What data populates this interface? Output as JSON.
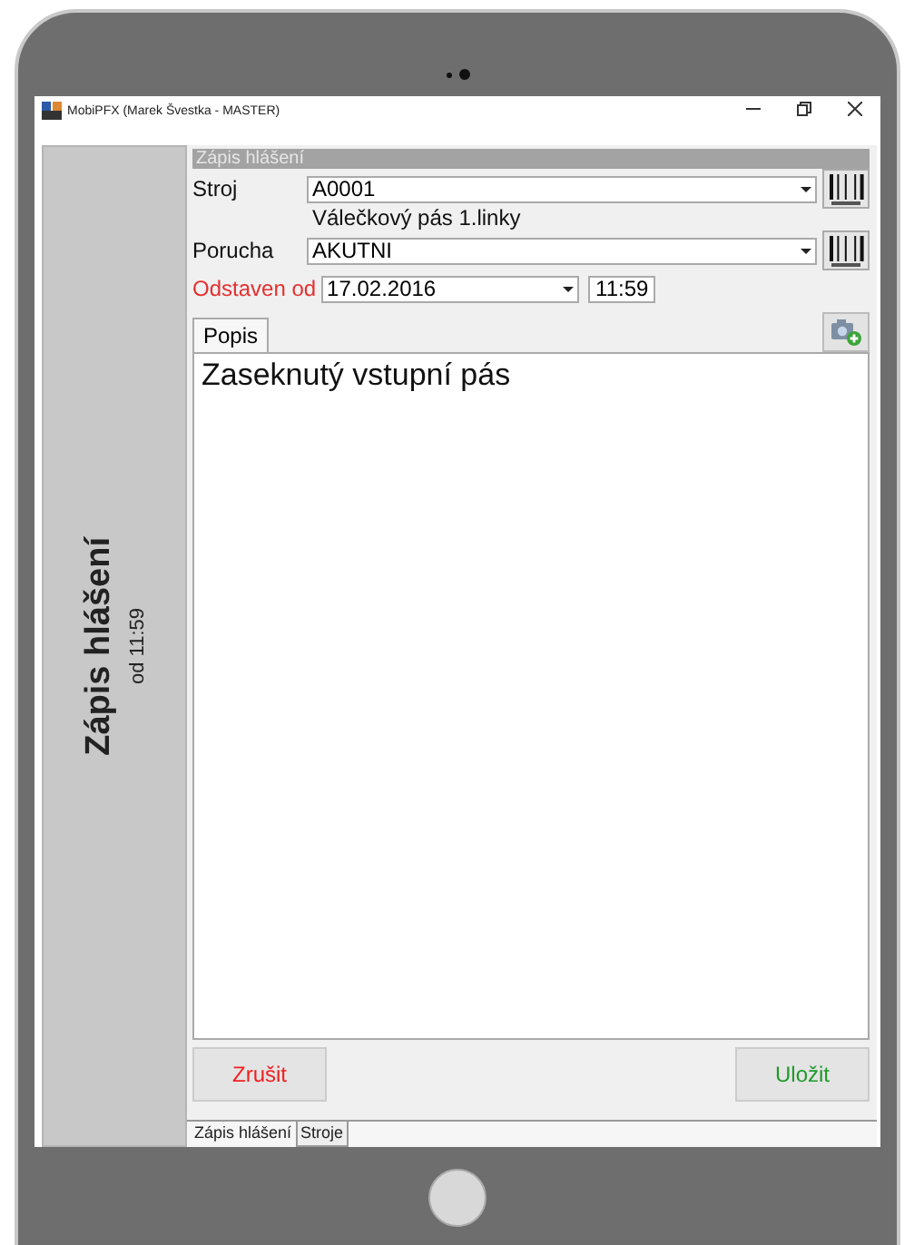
{
  "window": {
    "title": "MobiPFX (Marek Švestka - MASTER)"
  },
  "side_panel": {
    "title": "Zápis hlášení",
    "subtitle": "od 11:59"
  },
  "form": {
    "header": "Zápis hlášení",
    "fields": [
      {
        "kind": "combo",
        "label": "Stroj",
        "value": "A0001",
        "note": "Válečkový pás 1.linky",
        "required": false
      },
      {
        "kind": "combo",
        "label": "Porucha",
        "value": "AKUTNI",
        "required": false
      },
      {
        "kind": "datetime",
        "label": "Odstaven od",
        "value": "17.02.2016",
        "time": "11:59",
        "required": true
      }
    ]
  },
  "description_tabs": [
    {
      "label": "Popis",
      "selected": true
    }
  ],
  "description": {
    "value": "Zaseknutý vstupní pás"
  },
  "buttons": [
    {
      "label": "Zrušit",
      "kind": "cancel"
    },
    {
      "label": "Uložit",
      "kind": "save"
    }
  ],
  "bottom_tabs": [
    {
      "label": "Zápis hlášení",
      "selected": true
    },
    {
      "label": "Stroje",
      "selected": false
    }
  ]
}
